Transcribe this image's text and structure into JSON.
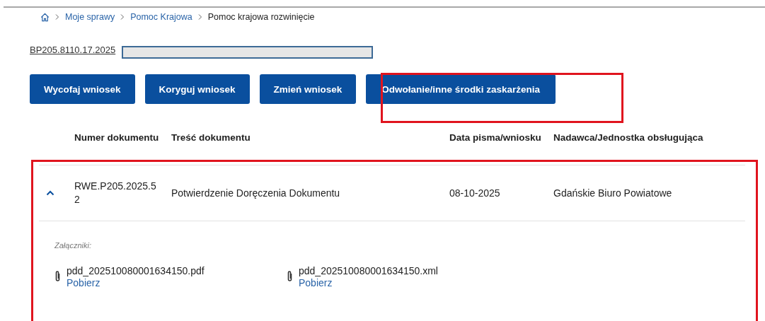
{
  "breadcrumb": [
    {
      "kind": "home"
    },
    {
      "kind": "link",
      "label": "Moje sprawy"
    },
    {
      "kind": "link",
      "label": "Pomoc Krajowa"
    },
    {
      "kind": "current",
      "label": "Pomoc krajowa rozwinięcie"
    }
  ],
  "case_number": "BP205.8110.17.2025",
  "buttons": [
    "Wycofaj wniosek",
    "Koryguj wniosek",
    "Zmień wniosek",
    "Odwołanie/inne środki zaskarżenia"
  ],
  "table": {
    "columns": [
      "Numer dokumentu",
      "Treść dokumentu",
      "Data pisma/wniosku",
      "Nadawca/Jednostka obsługująca"
    ],
    "rows": [
      {
        "expanded": true,
        "cells": [
          "RWE.P205.2025.52",
          "Potwierdzenie Doręczenia Dokumentu",
          "08-10-2025",
          "Gdańskie Biuro Powiatowe"
        ],
        "attachments_label": "Załączniki:",
        "attachments": [
          {
            "file": "pdd_202510080001634150.pdf",
            "link": "Pobierz"
          },
          {
            "file": "pdd_202510080001634150.xml",
            "link": "Pobierz"
          }
        ]
      }
    ]
  }
}
